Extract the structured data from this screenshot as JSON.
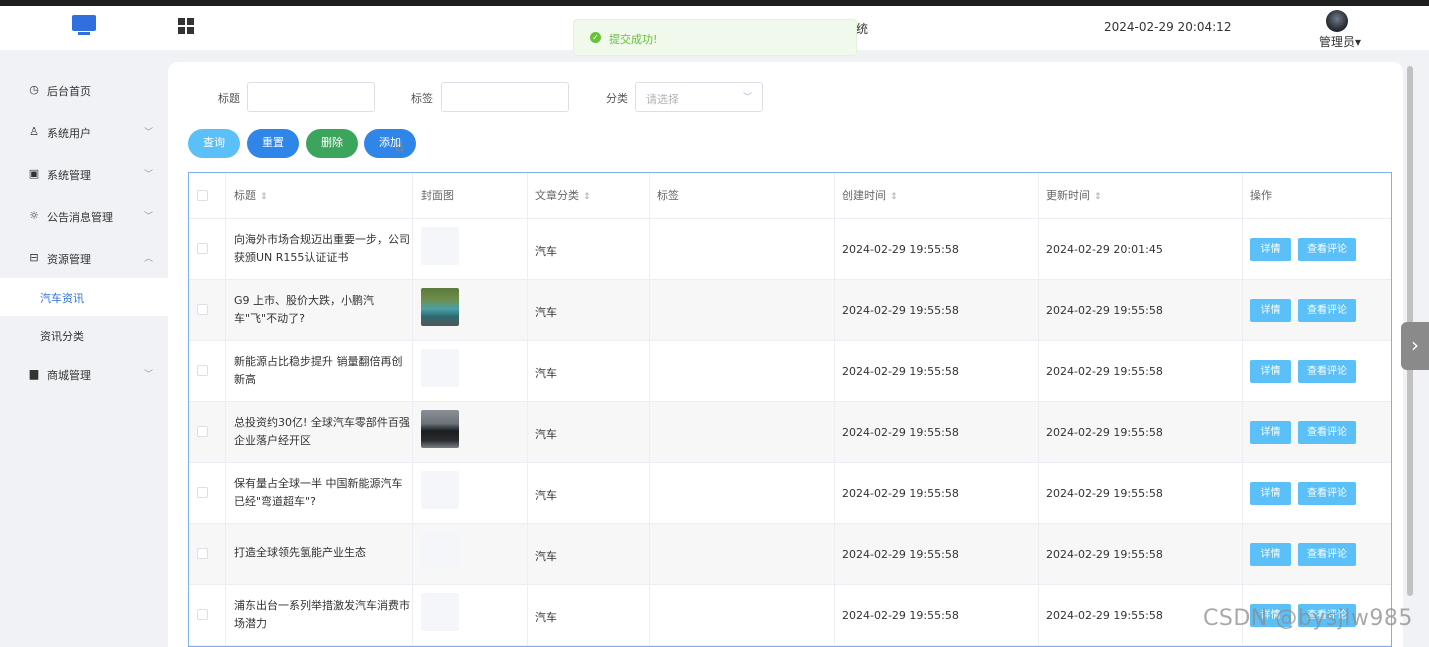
{
  "header": {
    "system_title": "统",
    "datetime": "2024-02-29 20:04:12",
    "user": "管理员",
    "user_caret": "▾"
  },
  "toast": {
    "message": "提交成功!",
    "icon": "check-circle-icon"
  },
  "sidebar": {
    "items": [
      {
        "label": "后台首页",
        "icon": "clock-icon",
        "glyph": "◷",
        "chev": ""
      },
      {
        "label": "系统用户",
        "icon": "user-icon",
        "glyph": "♙",
        "chev": "﹀"
      },
      {
        "label": "系统管理",
        "icon": "folder-icon",
        "glyph": "▣",
        "chev": "﹀"
      },
      {
        "label": "公告消息管理",
        "icon": "sun-icon",
        "glyph": "☼",
        "chev": "﹀"
      },
      {
        "label": "资源管理",
        "icon": "resource-icon",
        "glyph": "⊟",
        "chev": "︿"
      }
    ],
    "subitems": [
      {
        "label": "汽车资讯",
        "active": true
      },
      {
        "label": "资讯分类",
        "active": false
      }
    ],
    "shop": {
      "label": "商城管理",
      "icon": "shop-icon",
      "glyph": "▆",
      "chev": "﹀"
    }
  },
  "filters": {
    "title_label": "标题",
    "title_value": "",
    "tag_label": "标签",
    "tag_value": "",
    "category_label": "分类",
    "category_placeholder": "请选择"
  },
  "buttons": {
    "query": "查询",
    "reset": "重置",
    "delete": "删除",
    "add": "添加"
  },
  "table": {
    "headers": {
      "title": "标题",
      "cover": "封面图",
      "category": "文章分类",
      "tags": "标签",
      "created": "创建时间",
      "updated": "更新时间",
      "ops": "操作",
      "sort_glyph": "⇕"
    },
    "rows": [
      {
        "title": "向海外市场合规迈出重要一步，公司获颁UN R155认证证书",
        "cover": "",
        "category": "汽车",
        "tags": "",
        "created": "2024-02-29 19:55:58",
        "updated": "2024-02-29 20:01:45"
      },
      {
        "title": "G9 上市、股价大跌，小鹏汽车\"飞\"不动了?",
        "cover": "car1",
        "category": "汽车",
        "tags": "",
        "created": "2024-02-29 19:55:58",
        "updated": "2024-02-29 19:55:58"
      },
      {
        "title": "新能源占比稳步提升 销量翻倍再创新高",
        "cover": "",
        "category": "汽车",
        "tags": "",
        "created": "2024-02-29 19:55:58",
        "updated": "2024-02-29 19:55:58"
      },
      {
        "title": "总投资约30亿! 全球汽车零部件百强企业落户经开区",
        "cover": "car2",
        "category": "汽车",
        "tags": "",
        "created": "2024-02-29 19:55:58",
        "updated": "2024-02-29 19:55:58"
      },
      {
        "title": "保有量占全球一半 中国新能源汽车已经\"弯道超车\"?",
        "cover": "",
        "category": "汽车",
        "tags": "",
        "created": "2024-02-29 19:55:58",
        "updated": "2024-02-29 19:55:58"
      },
      {
        "title": "打造全球领先氢能产业生态",
        "cover": "",
        "category": "汽车",
        "tags": "",
        "created": "2024-02-29 19:55:58",
        "updated": "2024-02-29 19:55:58"
      },
      {
        "title": "浦东出台一系列举措激发汽车消费市场潜力",
        "cover": "",
        "category": "汽车",
        "tags": "",
        "created": "2024-02-29 19:55:58",
        "updated": "2024-02-29 19:55:58"
      }
    ],
    "op_detail": "详情",
    "op_comments": "查看评论"
  },
  "side_arrow": "›",
  "watermark": "CSDN @bysjlw985"
}
